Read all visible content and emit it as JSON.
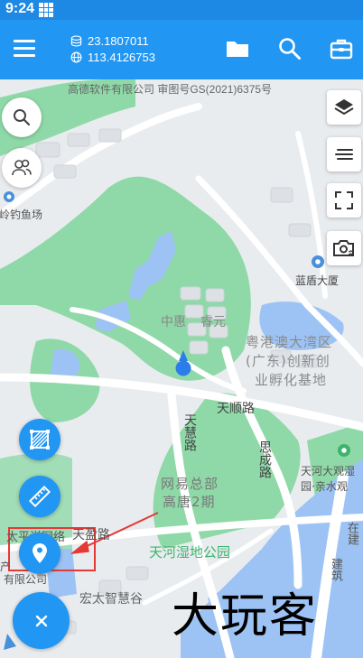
{
  "status_bar": {
    "time": "9:24"
  },
  "top_bar": {
    "latitude": "23.1807011",
    "longitude": "113.4126753",
    "icons": [
      "menu-icon",
      "folder-icon",
      "search-icon",
      "toolbox-icon"
    ]
  },
  "map": {
    "copyright": "高德软件有限公司 审图号GS(2021)6375号",
    "labels": {
      "fishing": "岭钓鱼场",
      "zhonghui": "中惠",
      "ruiyuan": "睿元",
      "gangao_1": "粤港澳大湾区",
      "gangao_2": "(广东)创新创",
      "gangao_3": "业孵化基地",
      "tianshun": "天顺路",
      "tianhui": "天慧路",
      "sicheng": "思成路",
      "lanhu": "蓝盾大厦",
      "wangyi_1": "网易总部",
      "wangyi_2": "高唐2期",
      "tianying": "天盈路",
      "wetland": "天河湿地公园",
      "tianhe_daguan_1": "天河大观湿",
      "tianhe_daguan_2": "园·亲水观",
      "hongtai": "宏太智慧谷",
      "taipingyang": "太平洋网络",
      "youxian": "有限公司",
      "chan": "产",
      "zai": "在建",
      "jianzhu": "建筑"
    }
  },
  "watermark": "大玩客",
  "colors": {
    "primary": "#2196f3",
    "status_bar": "#1e88e5",
    "green": "#8fd9a8",
    "water": "#9dc3f5"
  }
}
